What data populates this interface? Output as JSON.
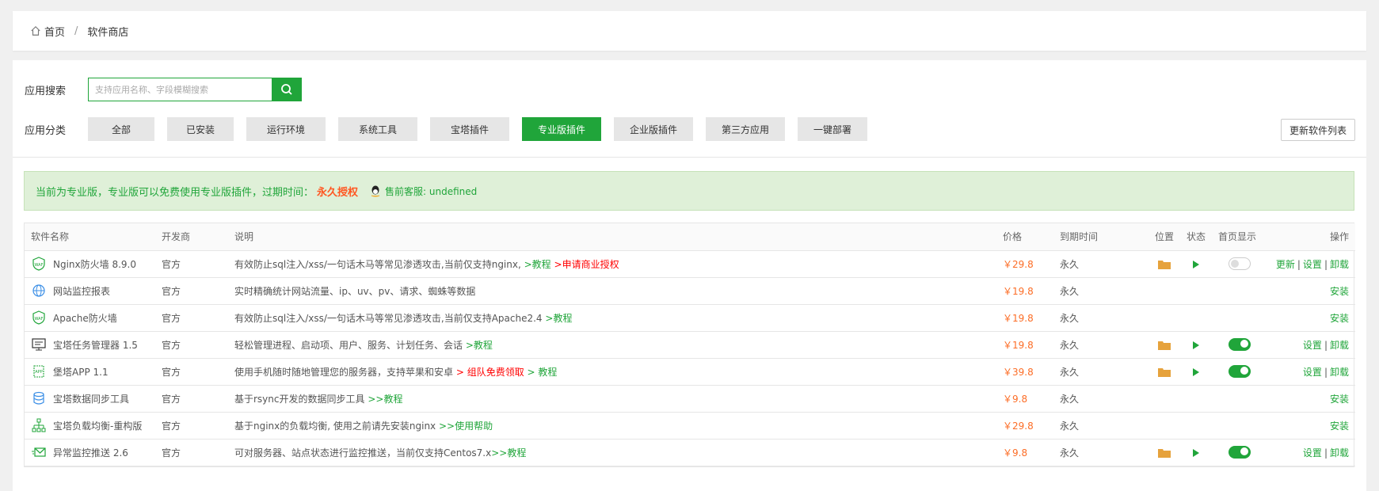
{
  "breadcrumb": {
    "home": "首页",
    "separator": "/",
    "current": "软件商店"
  },
  "search": {
    "label": "应用搜索",
    "placeholder": "支持应用名称、字段模糊搜索"
  },
  "category": {
    "label": "应用分类",
    "items": [
      {
        "label": "全部",
        "active": false
      },
      {
        "label": "已安装",
        "active": false
      },
      {
        "label": "运行环境",
        "active": false
      },
      {
        "label": "系统工具",
        "active": false
      },
      {
        "label": "宝塔插件",
        "active": false
      },
      {
        "label": "专业版插件",
        "active": true
      },
      {
        "label": "企业版插件",
        "active": false
      },
      {
        "label": "第三方应用",
        "active": false
      },
      {
        "label": "一键部署",
        "active": false
      }
    ]
  },
  "refresh_label": "更新软件列表",
  "notice": {
    "text": "当前为专业版，专业版可以免费使用专业版插件，过期时间：",
    "license": "永久授权",
    "service": "售前客服: undefined"
  },
  "table": {
    "headers": {
      "name": "软件名称",
      "dev": "开发商",
      "desc": "说明",
      "price": "价格",
      "expire": "到期时间",
      "pos": "位置",
      "status": "状态",
      "home": "首页显示",
      "ops": "操作"
    },
    "rows": [
      {
        "name": "Nginx防火墙 8.9.0",
        "dev": "官方",
        "desc": "有效防止sql注入/xss/一句话木马等常见渗透攻击,当前仅支持nginx,",
        "link1": ">教程",
        "link2": ">申请商业授权",
        "price": "￥29.8",
        "expire": "永久",
        "installed": true,
        "home_on": false,
        "op1": "更新",
        "op2": "设置",
        "op3": "卸载"
      },
      {
        "name": "网站监控报表",
        "dev": "官方",
        "desc": "实时精确统计网站流量、ip、uv、pv、请求、蜘蛛等数据",
        "link1": "",
        "link2": "",
        "price": "￥19.8",
        "expire": "永久",
        "installed": false,
        "op1": "安装"
      },
      {
        "name": "Apache防火墙",
        "dev": "官方",
        "desc": "有效防止sql注入/xss/一句话木马等常见渗透攻击,当前仅支持Apache2.4",
        "link1": ">教程",
        "link2": "",
        "price": "￥19.8",
        "expire": "永久",
        "installed": false,
        "op1": "安装"
      },
      {
        "name": "宝塔任务管理器 1.5",
        "dev": "官方",
        "desc": "轻松管理进程、启动项、用户、服务、计划任务、会话",
        "link1": ">教程",
        "link2": "",
        "price": "￥19.8",
        "expire": "永久",
        "installed": true,
        "home_on": true,
        "op2": "设置",
        "op3": "卸载"
      },
      {
        "name": "堡塔APP 1.1",
        "dev": "官方",
        "desc": "使用手机随时随地管理您的服务器，支持苹果和安卓",
        "link1": "",
        "link2": "> 组队免费领取",
        "link3": "> 教程",
        "price": "￥39.8",
        "expire": "永久",
        "installed": true,
        "home_on": true,
        "op2": "设置",
        "op3": "卸载"
      },
      {
        "name": "宝塔数据同步工具",
        "dev": "官方",
        "desc": "基于rsync开发的数据同步工具",
        "link1": ">>教程",
        "link2": "",
        "price": "￥9.8",
        "expire": "永久",
        "installed": false,
        "op1": "安装"
      },
      {
        "name": "宝塔负载均衡-重构版",
        "dev": "官方",
        "desc": "基于nginx的负载均衡, 使用之前请先安装nginx",
        "link1": ">>使用帮助",
        "link2": "",
        "price": "￥29.8",
        "expire": "永久",
        "installed": false,
        "op1": "安装"
      },
      {
        "name": "异常监控推送 2.6",
        "dev": "官方",
        "desc": "可对服务器、站点状态进行监控推送，当前仅支持Centos7.x",
        "link1": ">>教程",
        "link2": "",
        "price": "￥9.8",
        "expire": "永久",
        "installed": true,
        "home_on": true,
        "op2": "设置",
        "op3": "卸载"
      }
    ]
  },
  "colors": {
    "accent": "#20a53a",
    "price": "#fc6d26",
    "license": "#ff5722",
    "danger": "#ff0000"
  }
}
